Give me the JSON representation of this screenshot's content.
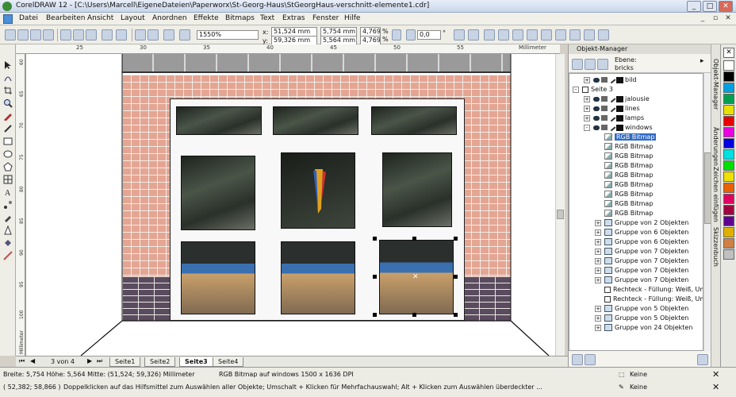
{
  "window": {
    "title": "CorelDRAW 12 - [C:\\Users\\Marcell\\EigeneDateien\\Paperworx\\St-Georg-Haus\\StGeorgHaus-verschnitt-elemente1.cdr]"
  },
  "menu": [
    "Datei",
    "Bearbeiten",
    "Ansicht",
    "Layout",
    "Anordnen",
    "Effekte",
    "Bitmaps",
    "Text",
    "Extras",
    "Fenster",
    "Hilfe"
  ],
  "toolbar": {
    "zoom": "1550%",
    "x_label": "x:",
    "x_value": "51,524 mm",
    "y_label": "y:",
    "y_value": "59,326 mm",
    "w_value": "5,754 mm",
    "h_value": "5,564 mm",
    "scale_x": "4,769",
    "scale_y": "4,769",
    "pct": "%",
    "angle": "0,0",
    "deg": "°"
  },
  "ruler": {
    "unit": "Millimeter",
    "h_ticks": [
      "25",
      "30",
      "35",
      "40",
      "45",
      "50",
      "55"
    ],
    "v_ticks": [
      "60",
      "65",
      "70",
      "75",
      "80",
      "85",
      "90",
      "95",
      "100"
    ],
    "v_label": "Millimeter"
  },
  "pages": {
    "counter": "3 von 4",
    "tabs": [
      "Seite1",
      "Seite2",
      "Seite3",
      "Seite4"
    ],
    "active": "Seite3"
  },
  "status": {
    "line1_left": "Breite: 5,754  Höhe: 5,564  Mitte: (51,524; 59,326) Millimeter",
    "line1_center": "RGB Bitmap auf windows 1500 x 1636 DPI",
    "line2_left": "( 52,382; 58,866 )",
    "line2_center": "Doppelklicken auf das Hilfsmittel zum Auswählen aller Objekte; Umschalt + Klicken für Mehrfachauswahl; Alt + Klicken zum Auswählen überdeckter ...",
    "fill": "Keine",
    "outline": "Keine"
  },
  "docker": {
    "title": "Objekt-Manager",
    "layer_label": "Ebene:",
    "layer_name": "bricks",
    "side_tabs": [
      "Objekt-Manager",
      "Änderungen",
      "Zeichen einfügen",
      "Skizzenbuch"
    ],
    "tree": [
      {
        "indent": 1,
        "type": "layer",
        "label": "bild",
        "exp": "+"
      },
      {
        "indent": 0,
        "type": "page",
        "label": "Seite 3",
        "exp": "-"
      },
      {
        "indent": 1,
        "type": "layer",
        "label": "jalousie",
        "exp": "+"
      },
      {
        "indent": 1,
        "type": "layer",
        "label": "lines",
        "exp": "+"
      },
      {
        "indent": 1,
        "type": "layer",
        "label": "lamps",
        "exp": "+"
      },
      {
        "indent": 1,
        "type": "layer",
        "label": "windows",
        "exp": "-"
      },
      {
        "indent": 2,
        "type": "bitmap",
        "label": "RGB Bitmap",
        "selected": true
      },
      {
        "indent": 2,
        "type": "bitmap",
        "label": "RGB Bitmap"
      },
      {
        "indent": 2,
        "type": "bitmap",
        "label": "RGB Bitmap"
      },
      {
        "indent": 2,
        "type": "bitmap",
        "label": "RGB Bitmap"
      },
      {
        "indent": 2,
        "type": "bitmap",
        "label": "RGB Bitmap"
      },
      {
        "indent": 2,
        "type": "bitmap",
        "label": "RGB Bitmap"
      },
      {
        "indent": 2,
        "type": "bitmap",
        "label": "RGB Bitmap"
      },
      {
        "indent": 2,
        "type": "bitmap",
        "label": "RGB Bitmap"
      },
      {
        "indent": 2,
        "type": "bitmap",
        "label": "RGB Bitmap"
      },
      {
        "indent": 2,
        "type": "group",
        "label": "Gruppe von 2 Objekten",
        "exp": "+"
      },
      {
        "indent": 2,
        "type": "group",
        "label": "Gruppe von 6 Objekten",
        "exp": "+"
      },
      {
        "indent": 2,
        "type": "group",
        "label": "Gruppe von 6 Objekten",
        "exp": "+"
      },
      {
        "indent": 2,
        "type": "group",
        "label": "Gruppe von 7 Objekten",
        "exp": "+"
      },
      {
        "indent": 2,
        "type": "group",
        "label": "Gruppe von 7 Objekten",
        "exp": "+"
      },
      {
        "indent": 2,
        "type": "group",
        "label": "Gruppe von 7 Objekten",
        "exp": "+"
      },
      {
        "indent": 2,
        "type": "group",
        "label": "Gruppe von 7 Objekten",
        "exp": "+"
      },
      {
        "indent": 2,
        "type": "rect",
        "label": "Rechteck - Füllung: Weiß, Umri"
      },
      {
        "indent": 2,
        "type": "rect",
        "label": "Rechteck - Füllung: Weiß, Umri"
      },
      {
        "indent": 2,
        "type": "group",
        "label": "Gruppe von 5 Objekten",
        "exp": "+"
      },
      {
        "indent": 2,
        "type": "group",
        "label": "Gruppe von 5 Objekten",
        "exp": "+"
      },
      {
        "indent": 2,
        "type": "group",
        "label": "Gruppe von 24 Objekten",
        "exp": "+"
      }
    ]
  },
  "palette": [
    "#ffffff",
    "#000000",
    "#00a0e0",
    "#00a050",
    "#e8e000",
    "#e80000",
    "#e800e0",
    "#0000e0",
    "#00e0e0",
    "#00e000",
    "#f0e000",
    "#e86000",
    "#e00060",
    "#a00040",
    "#600090",
    "#e0b000",
    "#d08040",
    "#c0c0c0"
  ]
}
